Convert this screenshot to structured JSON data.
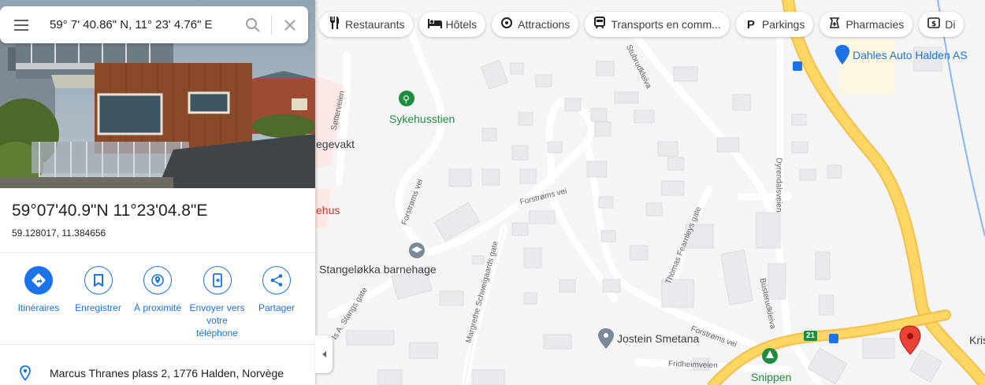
{
  "search": {
    "value": "59° 7' 40.86\" N, 11° 23' 4.76\" E"
  },
  "place": {
    "title": "59°07'40.9\"N 11°23'04.8\"E",
    "decimal": "59.128017, 11.384656",
    "address": "Marcus Thranes plass 2, 1776 Halden, Norvège"
  },
  "actions": [
    {
      "label": "Itinéraires",
      "icon": "directions-icon"
    },
    {
      "label": "Enregistrer",
      "icon": "bookmark-icon"
    },
    {
      "label": "À proximité",
      "icon": "nearby-icon"
    },
    {
      "label": "Envoyer vers votre téléphone",
      "icon": "phone-icon"
    },
    {
      "label": "Partager",
      "icon": "share-icon"
    }
  ],
  "chips": [
    {
      "label": "Restaurants",
      "icon": "restaurant-icon"
    },
    {
      "label": "Hôtels",
      "icon": "hotel-icon"
    },
    {
      "label": "Attractions",
      "icon": "attraction-icon"
    },
    {
      "label": "Transports en comm...",
      "icon": "transit-icon"
    },
    {
      "label": "Parkings",
      "icon": "parking-icon"
    },
    {
      "label": "Pharmacies",
      "icon": "pharmacy-icon"
    },
    {
      "label": "Di",
      "icon": "atm-icon"
    }
  ],
  "map": {
    "places": {
      "sykehusstien": "Sykehusstien",
      "dahles": "Dahles Auto Halden AS",
      "stangelokka": "Stangeløkka barnehage",
      "jostein": "Jostein Smetana",
      "snippen": "Snippen",
      "legevakt": "egevakt",
      "sykehus": "ehus",
      "kris": "Kris"
    },
    "streets": {
      "sorveien": "Søtterveien",
      "forstroms1": "Forstrøms vei",
      "forstroms2": "Forstrøms vei",
      "forstroms3": "Forstrøms vei",
      "stubruckleiva": "Stubrudkleiva",
      "dyrendal": "Dyrendalsveien",
      "thomas": "Thomas Fearnleys gate",
      "margrethe": "Margrethe Schweigaards gate",
      "bustrud": "Busterudkleiva",
      "fridheim": "Fridheimveien",
      "astang": "Is A. Stangs gate"
    },
    "road_number": "21"
  },
  "colors": {
    "accent": "#1a73e8",
    "major_road": "#fdd663",
    "park_green": "#1e8e3e",
    "pin_red": "#ea4335"
  }
}
